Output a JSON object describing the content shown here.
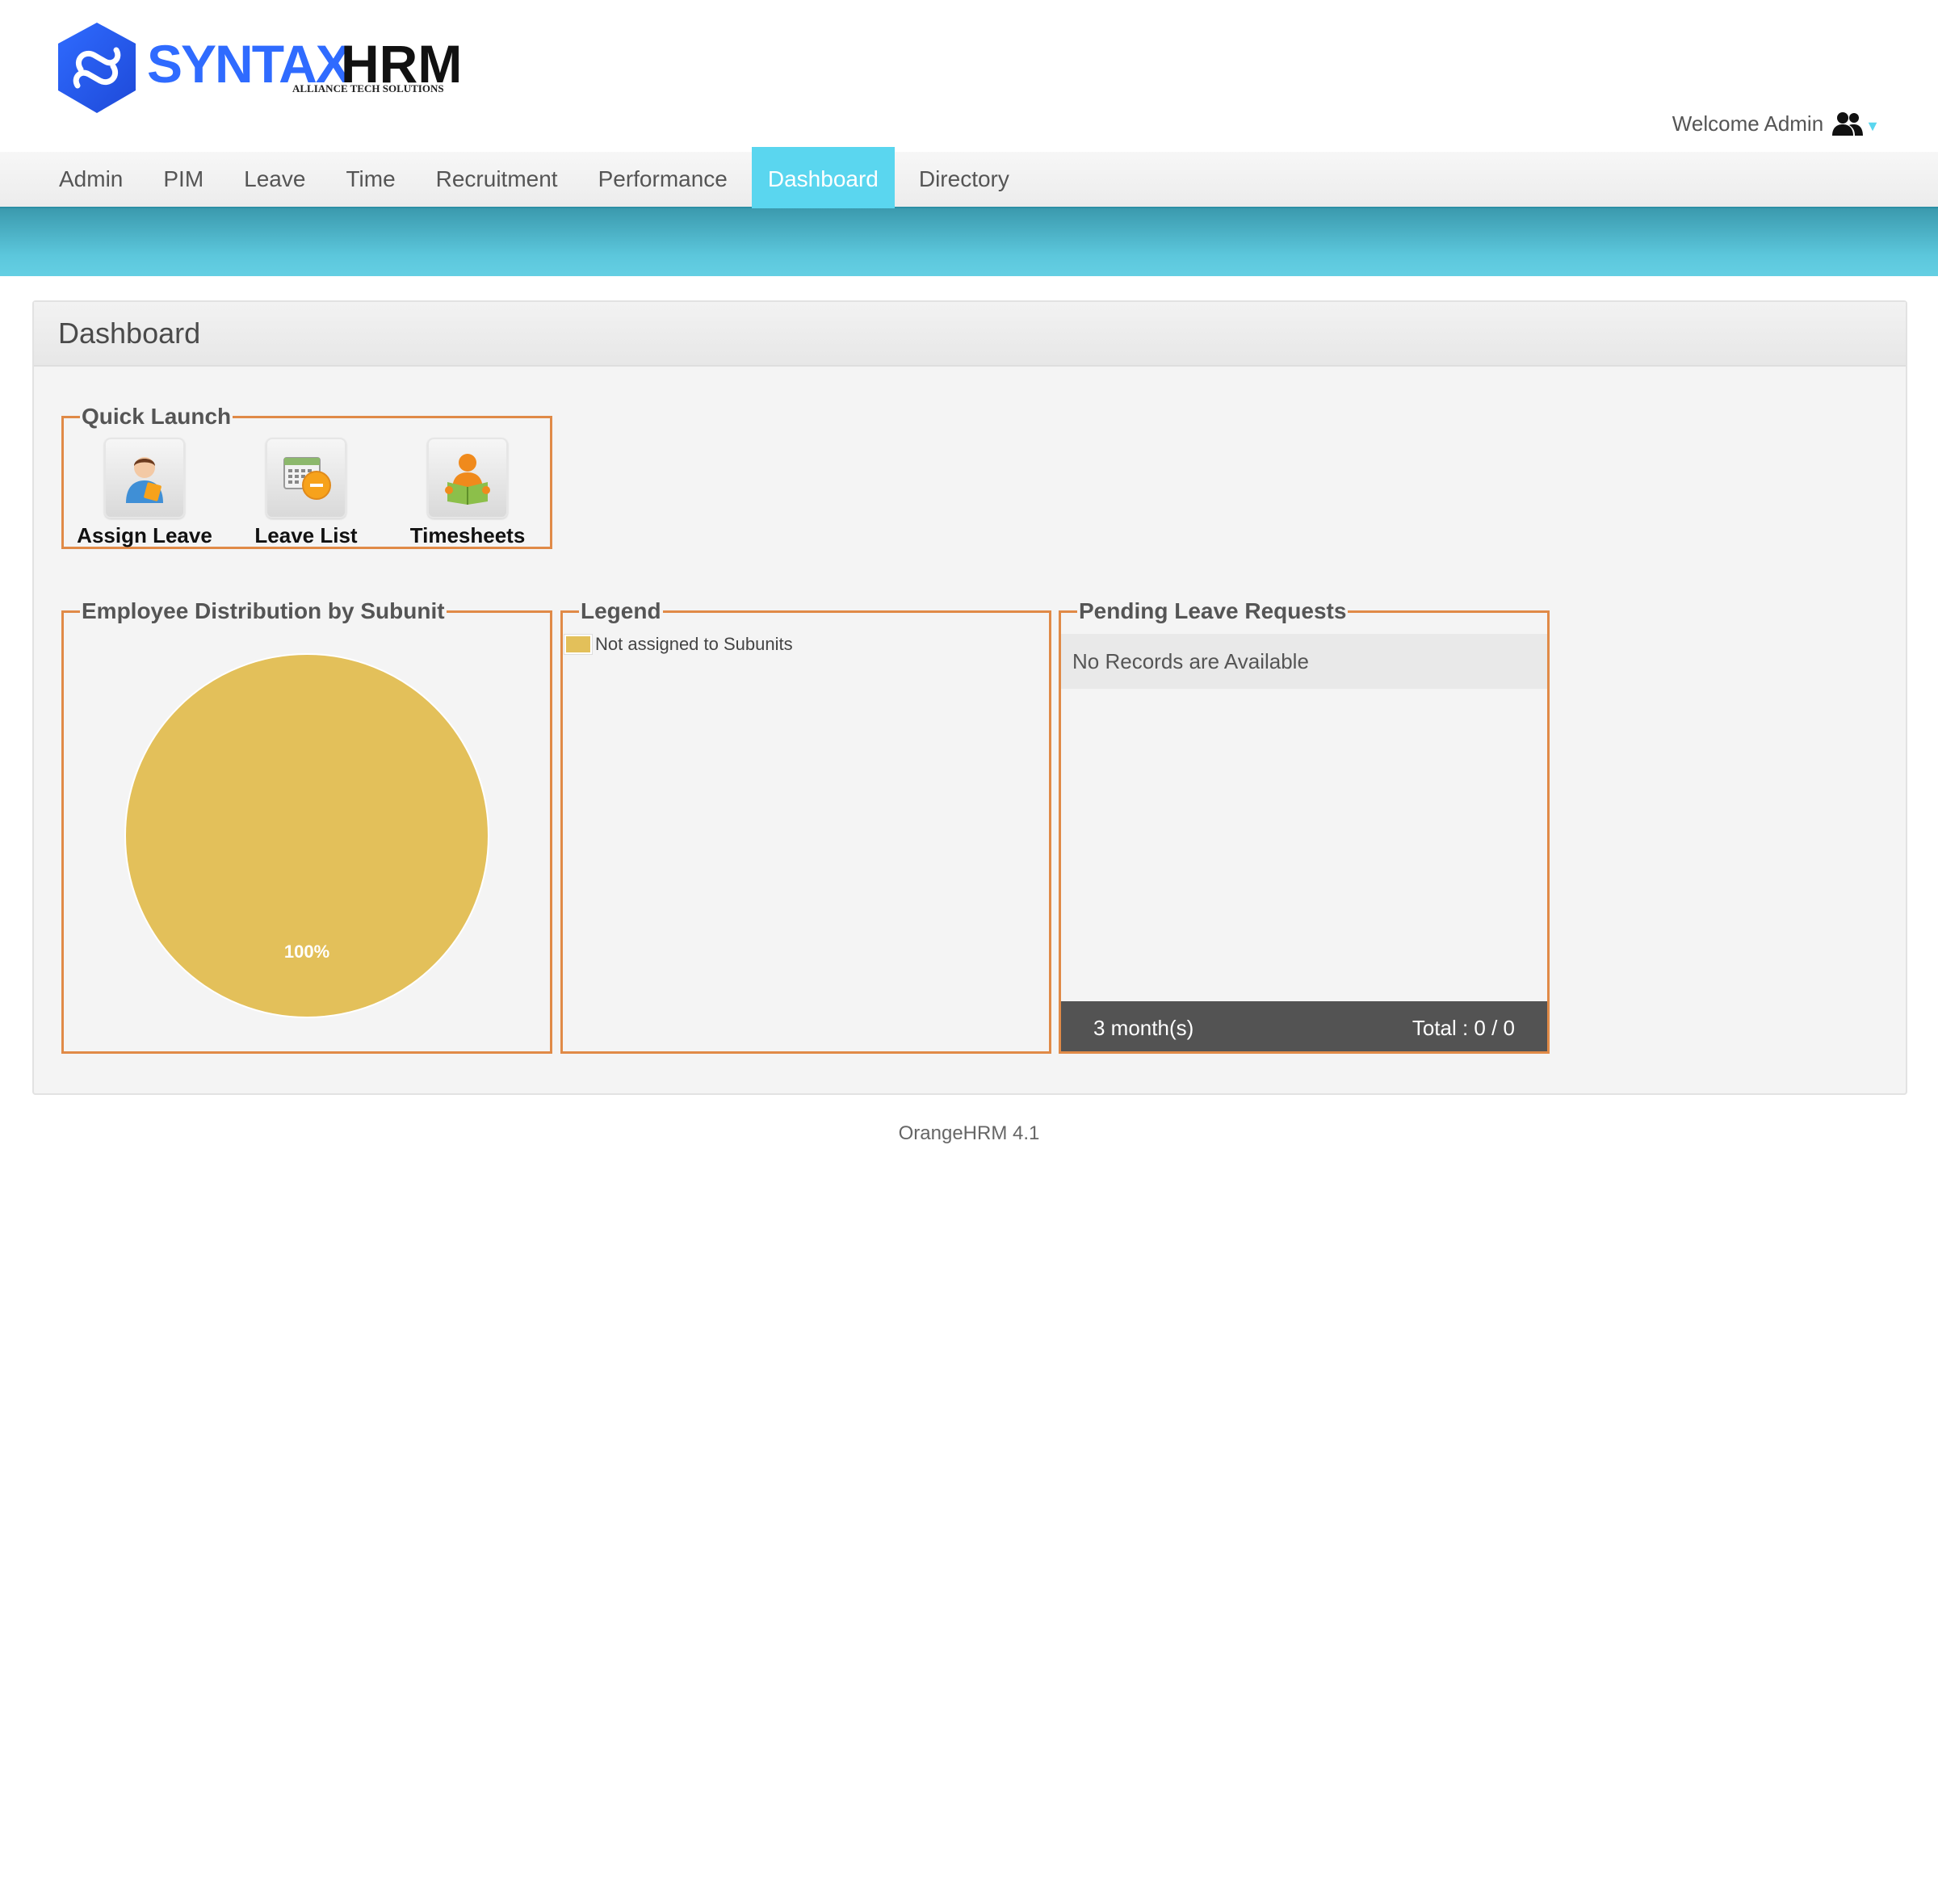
{
  "brand": {
    "name_part1": "SYNTAX",
    "name_part2": "HRM",
    "tagline": "ALLIANCE TECH SOLUTIONS",
    "color_primary": "#2f6bff",
    "color_dark": "#111111"
  },
  "header": {
    "welcome_text": "Welcome Admin",
    "user_icon": "users-icon",
    "accent_color": "#5ad6ef"
  },
  "nav": {
    "items": [
      {
        "label": "Admin",
        "active": false
      },
      {
        "label": "PIM",
        "active": false
      },
      {
        "label": "Leave",
        "active": false
      },
      {
        "label": "Time",
        "active": false
      },
      {
        "label": "Recruitment",
        "active": false
      },
      {
        "label": "Performance",
        "active": false
      },
      {
        "label": "Dashboard",
        "active": true
      },
      {
        "label": "Directory",
        "active": false
      }
    ]
  },
  "page": {
    "title": "Dashboard"
  },
  "quick_launch": {
    "title": "Quick Launch",
    "items": [
      {
        "label": "Assign Leave",
        "icon": "assign-leave-icon"
      },
      {
        "label": "Leave List",
        "icon": "leave-list-icon"
      },
      {
        "label": "Timesheets",
        "icon": "timesheets-icon"
      }
    ]
  },
  "distribution": {
    "title": "Employee Distribution by Subunit"
  },
  "chart_data": {
    "type": "pie",
    "categories": [
      "Not assigned to Subunits"
    ],
    "values": [
      100
    ],
    "data_labels": [
      "100%"
    ],
    "colors": [
      "#e3c05a"
    ],
    "legend_position": "separate-panel"
  },
  "legend": {
    "title": "Legend",
    "items": [
      {
        "label": "Not assigned to Subunits",
        "color": "#e3c05a"
      }
    ]
  },
  "pending": {
    "title": "Pending Leave Requests",
    "empty_text": "No Records are Available",
    "period": "3 month(s)",
    "total": "Total : 0 / 0"
  },
  "footer": {
    "text": "OrangeHRM 4.1"
  }
}
